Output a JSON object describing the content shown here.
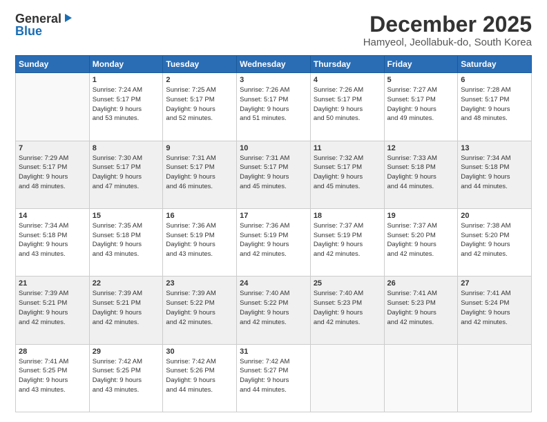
{
  "logo": {
    "general": "General",
    "blue": "Blue"
  },
  "header": {
    "month": "December 2025",
    "location": "Hamyeol, Jeollabuk-do, South Korea"
  },
  "weekdays": [
    "Sunday",
    "Monday",
    "Tuesday",
    "Wednesday",
    "Thursday",
    "Friday",
    "Saturday"
  ],
  "weeks": [
    [
      {
        "day": "",
        "info": ""
      },
      {
        "day": "1",
        "info": "Sunrise: 7:24 AM\nSunset: 5:17 PM\nDaylight: 9 hours\nand 53 minutes."
      },
      {
        "day": "2",
        "info": "Sunrise: 7:25 AM\nSunset: 5:17 PM\nDaylight: 9 hours\nand 52 minutes."
      },
      {
        "day": "3",
        "info": "Sunrise: 7:26 AM\nSunset: 5:17 PM\nDaylight: 9 hours\nand 51 minutes."
      },
      {
        "day": "4",
        "info": "Sunrise: 7:26 AM\nSunset: 5:17 PM\nDaylight: 9 hours\nand 50 minutes."
      },
      {
        "day": "5",
        "info": "Sunrise: 7:27 AM\nSunset: 5:17 PM\nDaylight: 9 hours\nand 49 minutes."
      },
      {
        "day": "6",
        "info": "Sunrise: 7:28 AM\nSunset: 5:17 PM\nDaylight: 9 hours\nand 48 minutes."
      }
    ],
    [
      {
        "day": "7",
        "info": "Sunrise: 7:29 AM\nSunset: 5:17 PM\nDaylight: 9 hours\nand 48 minutes."
      },
      {
        "day": "8",
        "info": "Sunrise: 7:30 AM\nSunset: 5:17 PM\nDaylight: 9 hours\nand 47 minutes."
      },
      {
        "day": "9",
        "info": "Sunrise: 7:31 AM\nSunset: 5:17 PM\nDaylight: 9 hours\nand 46 minutes."
      },
      {
        "day": "10",
        "info": "Sunrise: 7:31 AM\nSunset: 5:17 PM\nDaylight: 9 hours\nand 45 minutes."
      },
      {
        "day": "11",
        "info": "Sunrise: 7:32 AM\nSunset: 5:17 PM\nDaylight: 9 hours\nand 45 minutes."
      },
      {
        "day": "12",
        "info": "Sunrise: 7:33 AM\nSunset: 5:18 PM\nDaylight: 9 hours\nand 44 minutes."
      },
      {
        "day": "13",
        "info": "Sunrise: 7:34 AM\nSunset: 5:18 PM\nDaylight: 9 hours\nand 44 minutes."
      }
    ],
    [
      {
        "day": "14",
        "info": "Sunrise: 7:34 AM\nSunset: 5:18 PM\nDaylight: 9 hours\nand 43 minutes."
      },
      {
        "day": "15",
        "info": "Sunrise: 7:35 AM\nSunset: 5:18 PM\nDaylight: 9 hours\nand 43 minutes."
      },
      {
        "day": "16",
        "info": "Sunrise: 7:36 AM\nSunset: 5:19 PM\nDaylight: 9 hours\nand 43 minutes."
      },
      {
        "day": "17",
        "info": "Sunrise: 7:36 AM\nSunset: 5:19 PM\nDaylight: 9 hours\nand 42 minutes."
      },
      {
        "day": "18",
        "info": "Sunrise: 7:37 AM\nSunset: 5:19 PM\nDaylight: 9 hours\nand 42 minutes."
      },
      {
        "day": "19",
        "info": "Sunrise: 7:37 AM\nSunset: 5:20 PM\nDaylight: 9 hours\nand 42 minutes."
      },
      {
        "day": "20",
        "info": "Sunrise: 7:38 AM\nSunset: 5:20 PM\nDaylight: 9 hours\nand 42 minutes."
      }
    ],
    [
      {
        "day": "21",
        "info": "Sunrise: 7:39 AM\nSunset: 5:21 PM\nDaylight: 9 hours\nand 42 minutes."
      },
      {
        "day": "22",
        "info": "Sunrise: 7:39 AM\nSunset: 5:21 PM\nDaylight: 9 hours\nand 42 minutes."
      },
      {
        "day": "23",
        "info": "Sunrise: 7:39 AM\nSunset: 5:22 PM\nDaylight: 9 hours\nand 42 minutes."
      },
      {
        "day": "24",
        "info": "Sunrise: 7:40 AM\nSunset: 5:22 PM\nDaylight: 9 hours\nand 42 minutes."
      },
      {
        "day": "25",
        "info": "Sunrise: 7:40 AM\nSunset: 5:23 PM\nDaylight: 9 hours\nand 42 minutes."
      },
      {
        "day": "26",
        "info": "Sunrise: 7:41 AM\nSunset: 5:23 PM\nDaylight: 9 hours\nand 42 minutes."
      },
      {
        "day": "27",
        "info": "Sunrise: 7:41 AM\nSunset: 5:24 PM\nDaylight: 9 hours\nand 42 minutes."
      }
    ],
    [
      {
        "day": "28",
        "info": "Sunrise: 7:41 AM\nSunset: 5:25 PM\nDaylight: 9 hours\nand 43 minutes."
      },
      {
        "day": "29",
        "info": "Sunrise: 7:42 AM\nSunset: 5:25 PM\nDaylight: 9 hours\nand 43 minutes."
      },
      {
        "day": "30",
        "info": "Sunrise: 7:42 AM\nSunset: 5:26 PM\nDaylight: 9 hours\nand 44 minutes."
      },
      {
        "day": "31",
        "info": "Sunrise: 7:42 AM\nSunset: 5:27 PM\nDaylight: 9 hours\nand 44 minutes."
      },
      {
        "day": "",
        "info": ""
      },
      {
        "day": "",
        "info": ""
      },
      {
        "day": "",
        "info": ""
      }
    ]
  ]
}
